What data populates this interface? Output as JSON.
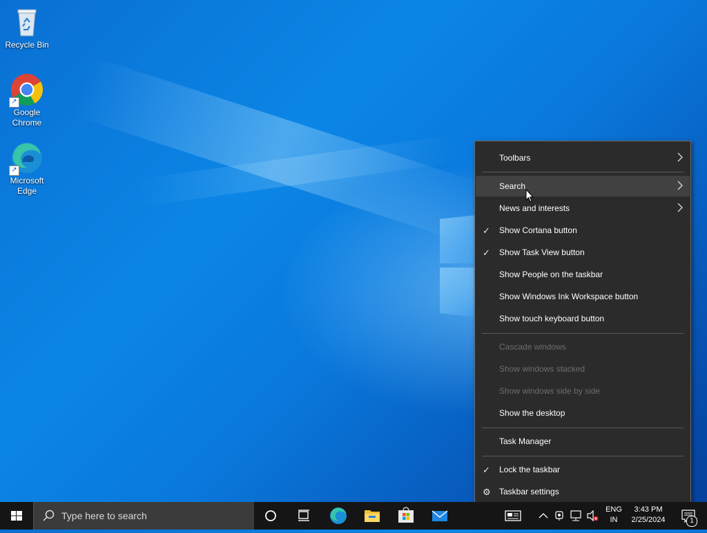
{
  "desktop": {
    "icons": [
      {
        "label": "Recycle Bin",
        "icon": "recycle-bin-icon"
      },
      {
        "label": "Google\nChrome",
        "icon": "chrome-icon"
      },
      {
        "label": "Microsoft\nEdge",
        "icon": "edge-icon"
      }
    ]
  },
  "context_menu": {
    "items": [
      {
        "label": "Toolbars",
        "checked": false,
        "submenu": true,
        "disabled": false
      },
      {
        "label": "Search",
        "checked": false,
        "submenu": true,
        "disabled": false,
        "highlighted": true
      },
      {
        "label": "News and interests",
        "checked": false,
        "submenu": true,
        "disabled": false
      },
      {
        "label": "Show Cortana button",
        "checked": true,
        "submenu": false,
        "disabled": false
      },
      {
        "label": "Show Task View button",
        "checked": true,
        "submenu": false,
        "disabled": false
      },
      {
        "label": "Show People on the taskbar",
        "checked": false,
        "submenu": false,
        "disabled": false
      },
      {
        "label": "Show Windows Ink Workspace button",
        "checked": false,
        "submenu": false,
        "disabled": false
      },
      {
        "label": "Show touch keyboard button",
        "checked": false,
        "submenu": false,
        "disabled": false
      },
      {
        "label": "Cascade windows",
        "checked": false,
        "submenu": false,
        "disabled": true
      },
      {
        "label": "Show windows stacked",
        "checked": false,
        "submenu": false,
        "disabled": true
      },
      {
        "label": "Show windows side by side",
        "checked": false,
        "submenu": false,
        "disabled": true
      },
      {
        "label": "Show the desktop",
        "checked": false,
        "submenu": false,
        "disabled": false
      },
      {
        "label": "Task Manager",
        "checked": false,
        "submenu": false,
        "disabled": false
      },
      {
        "label": "Lock the taskbar",
        "checked": true,
        "submenu": false,
        "disabled": false
      },
      {
        "label": "Taskbar settings",
        "checked": false,
        "submenu": false,
        "disabled": false,
        "icon": "gear-icon"
      }
    ]
  },
  "taskbar": {
    "search_placeholder": "Type here to search",
    "pinned": [
      "cortana-icon",
      "task-view-icon",
      "edge-icon",
      "file-explorer-icon",
      "microsoft-store-icon",
      "mail-icon"
    ],
    "tray": {
      "language_line1": "ENG",
      "language_line2": "IN",
      "time": "3:43 PM",
      "date": "2/25/2024",
      "notification_count": "1"
    }
  },
  "colors": {
    "menu_bg": "#2b2b2b",
    "menu_hover": "#414141",
    "taskbar_bg": "#151515",
    "desktop_accent": "#0a78dc"
  }
}
